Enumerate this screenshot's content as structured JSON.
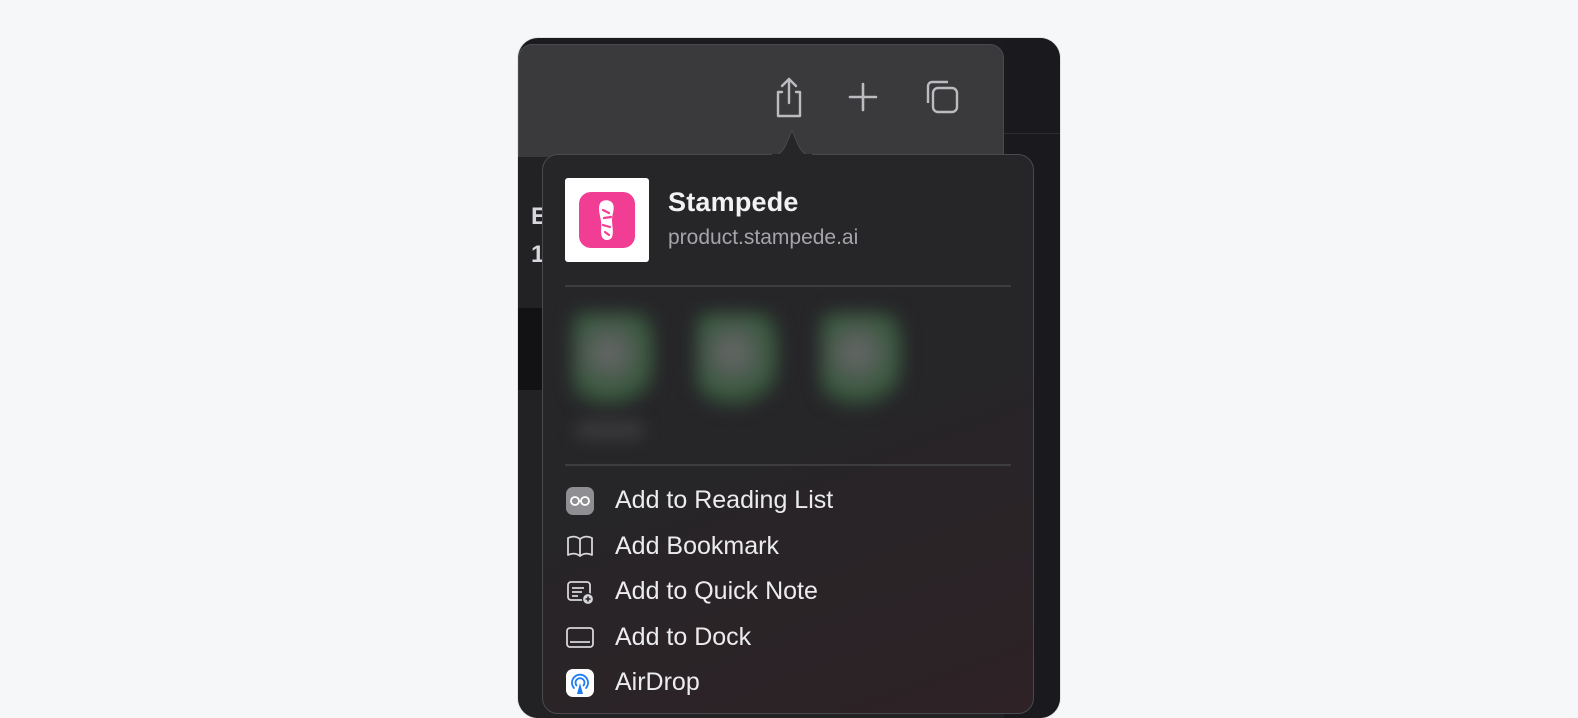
{
  "toolbar": {
    "buttons": [
      {
        "name": "share-icon"
      },
      {
        "name": "new-tab-icon"
      },
      {
        "name": "tab-overview-icon"
      }
    ]
  },
  "background_fragments": [
    "E",
    "1"
  ],
  "share_sheet": {
    "title": "Stampede",
    "url": "product.stampede.ai",
    "app_icon_color": "#f23d94",
    "contacts_count_visible": 3,
    "items": [
      {
        "label": "Add to Reading List",
        "icon": "reading-glasses-icon"
      },
      {
        "label": "Add Bookmark",
        "icon": "book-icon"
      },
      {
        "label": "Add to Quick Note",
        "icon": "quick-note-icon"
      },
      {
        "label": "Add to Dock",
        "icon": "dock-icon"
      },
      {
        "label": "AirDrop",
        "icon": "airdrop-icon"
      }
    ]
  }
}
